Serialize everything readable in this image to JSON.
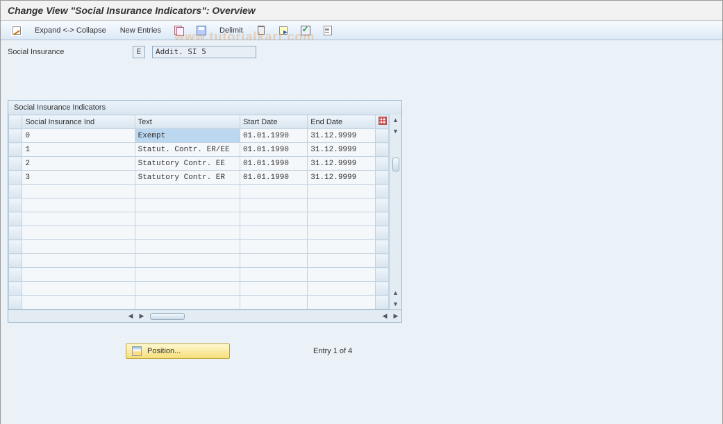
{
  "header": {
    "title": "Change View \"Social Insurance Indicators\": Overview"
  },
  "toolbar": {
    "expand_collapse": "Expand <-> Collapse",
    "new_entries": "New Entries",
    "delimit": "Delimit"
  },
  "form": {
    "social_insurance_label": "Social Insurance",
    "social_insurance_code": "E",
    "social_insurance_desc": "Addit. SI 5"
  },
  "panel": {
    "title": "Social Insurance Indicators",
    "columns": {
      "ind": "Social Insurance Ind",
      "text": "Text",
      "start": "Start Date",
      "end": "End Date"
    },
    "rows": [
      {
        "ind": "0",
        "text": "Exempt",
        "start": "01.01.1990",
        "end": "31.12.9999",
        "highlight": true
      },
      {
        "ind": "1",
        "text": "Statut. Contr. ER/EE",
        "start": "01.01.1990",
        "end": "31.12.9999"
      },
      {
        "ind": "2",
        "text": "Statutory Contr. EE",
        "start": "01.01.1990",
        "end": "31.12.9999"
      },
      {
        "ind": "3",
        "text": "Statutory Contr. ER",
        "start": "01.01.1990",
        "end": "31.12.9999"
      }
    ],
    "empty_rows": 9
  },
  "footer": {
    "position_btn": "Position...",
    "entry_text": "Entry 1 of 4"
  },
  "watermark": "www.tutorialkart.com"
}
